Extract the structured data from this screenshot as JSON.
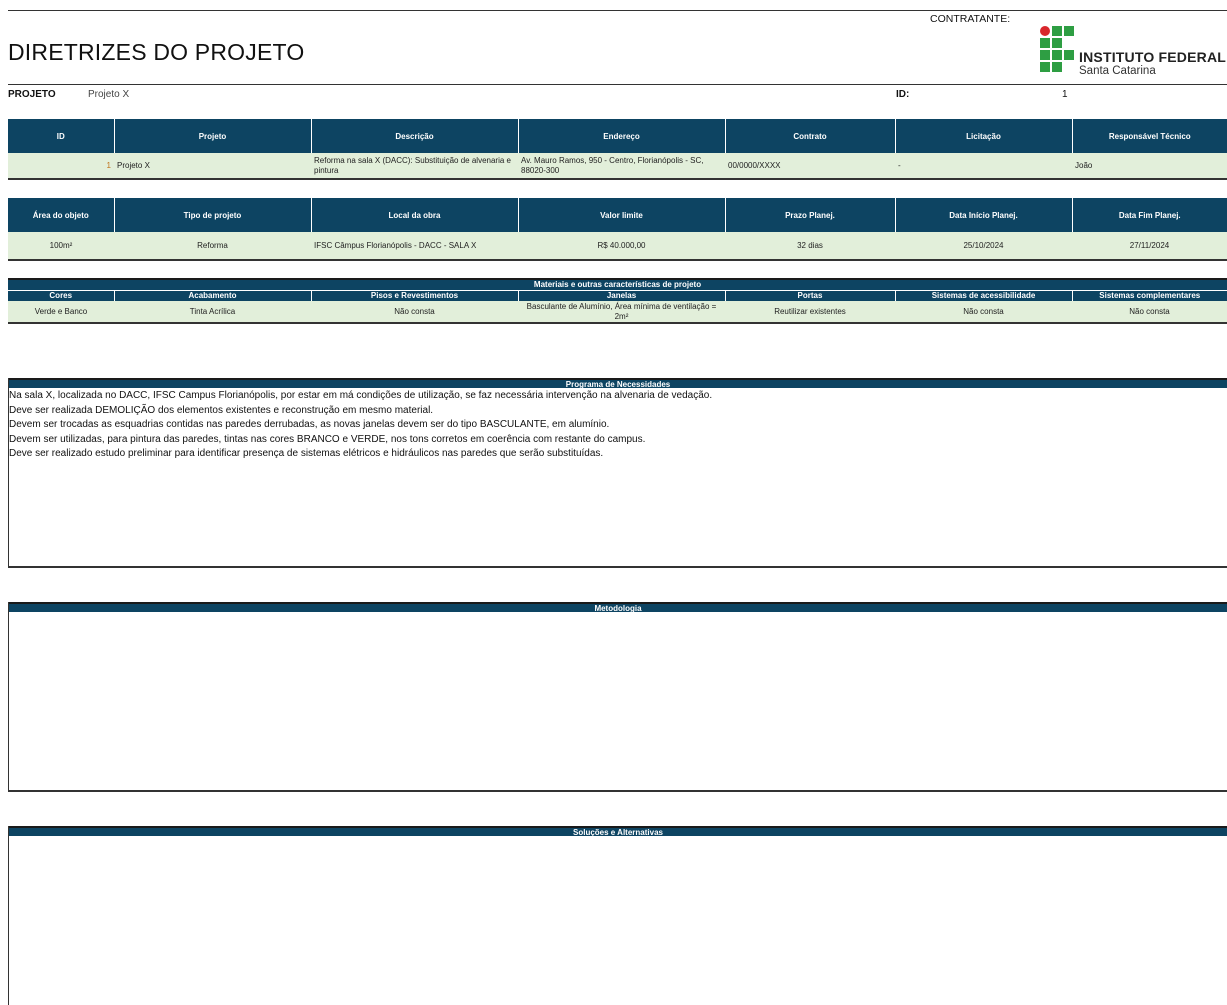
{
  "header": {
    "title": "DIRETRIZES DO PROJETO",
    "contratante_label": "CONTRATANTE:",
    "logo_name": "INSTITUTO FEDERAL",
    "logo_sub": "Santa Catarina"
  },
  "project_row": {
    "projeto_label": "PROJETO",
    "projeto_value": "Projeto X",
    "id_label": "ID:",
    "id_value": "1"
  },
  "table1": {
    "headers": [
      "ID",
      "Projeto",
      "Descrição",
      "Endereço",
      "Contrato",
      "Licitação",
      "Responsável Técnico"
    ],
    "row": {
      "id": "1",
      "projeto": "Projeto X",
      "descricao": "Reforma na sala X (DACC): Substituição de alvenaria e pintura",
      "endereco": "Av. Mauro Ramos, 950 - Centro, Florianópolis - SC, 88020-300",
      "contrato": "00/0000/XXXX",
      "licitacao": "-",
      "responsavel": "João"
    }
  },
  "table2": {
    "headers": [
      "Área do objeto",
      "Tipo de projeto",
      "Local da obra",
      "Valor limite",
      "Prazo Planej.",
      "Data Início Planej.",
      "Data Fim Planej."
    ],
    "row": [
      "100m²",
      "Reforma",
      "IFSC Câmpus Florianópolis - DACC - SALA X",
      "R$ 40.000,00",
      "32 dias",
      "25/10/2024",
      "27/11/2024"
    ]
  },
  "table3": {
    "title": "Materiais e outras características de projeto",
    "headers": [
      "Cores",
      "Acabamento",
      "Pisos e Revestimentos",
      "Janelas",
      "Portas",
      "Sistemas de acessibilidade",
      "Sistemas complementares"
    ],
    "row": [
      "Verde e Banco",
      "Tinta Acrílica",
      "Não consta",
      "Basculante de Alumínio, Área mínima de ventilação = 2m²",
      "Reutilizar existentes",
      "Não consta",
      "Não consta"
    ]
  },
  "programa": {
    "title": "Programa de Necessidades",
    "lines": [
      "Na sala X, localizada no DACC, IFSC Campus Florianópolis, por estar em má condições de utilização, se faz necessária intervenção na alvenaria de vedação.",
      "Deve ser realizada DEMOLIÇÃO dos elementos existentes e reconstrução em mesmo material.",
      "Devem ser trocadas as esquadrias contidas nas paredes derrubadas, as novas janelas devem ser do tipo BASCULANTE, em alumínio.",
      "Devem ser utilizadas, para pintura das paredes, tintas nas cores BRANCO e VERDE, nos tons corretos em coerência com restante do campus.",
      "Deve ser realizado estudo preliminar para identificar presença de sistemas elétricos e hidráulicos nas paredes que serão substituídas."
    ]
  },
  "metodologia": {
    "title": "Metodologia"
  },
  "solucoes": {
    "title": "Soluções e Alternativas"
  },
  "colors": {
    "header_blue": "#0d4462",
    "row_green": "#e2efda",
    "logo_green": "#2e9e43",
    "logo_red": "#d9262c"
  }
}
